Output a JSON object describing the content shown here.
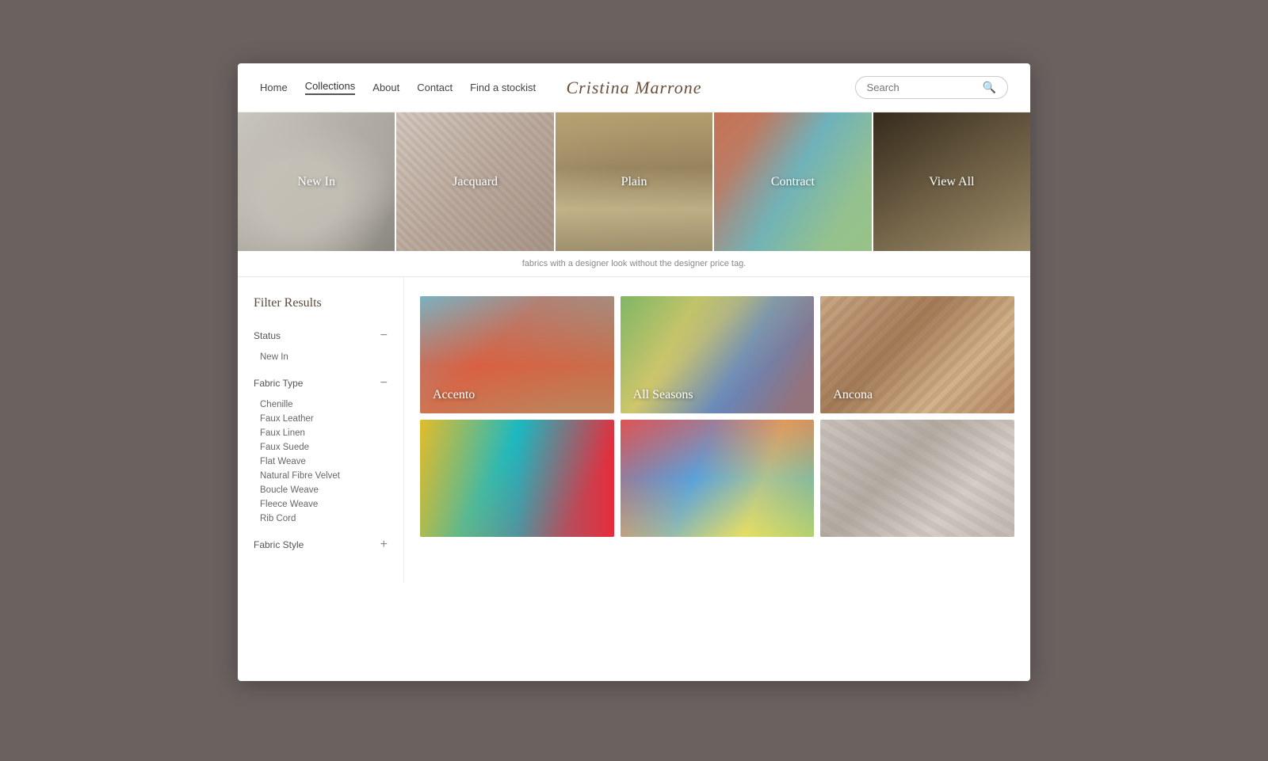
{
  "nav": {
    "links": [
      {
        "label": "Home",
        "active": false
      },
      {
        "label": "Collections",
        "active": true
      },
      {
        "label": "About",
        "active": false
      },
      {
        "label": "Contact",
        "active": false
      },
      {
        "label": "Find a stockist",
        "active": false
      }
    ],
    "logo": "Cristina Marrone",
    "search_placeholder": "Search"
  },
  "hero_banners": [
    {
      "label": "New In",
      "css_class": "banner-new-in"
    },
    {
      "label": "Jacquard",
      "css_class": "banner-jacquard"
    },
    {
      "label": "Plain",
      "css_class": "banner-plain"
    },
    {
      "label": "Contract",
      "css_class": "banner-contract"
    },
    {
      "label": "View All",
      "css_class": "banner-viewall"
    }
  ],
  "tagline": "fabrics with a designer look without the designer price tag.",
  "sidebar": {
    "title": "Filter Results",
    "sections": [
      {
        "name": "Status",
        "expanded": true,
        "items": [
          "New In"
        ]
      },
      {
        "name": "Fabric Type",
        "expanded": true,
        "items": [
          "Chenille",
          "Faux Leather",
          "Faux Linen",
          "Faux Suede",
          "Flat Weave",
          "Natural Fibre Velvet",
          "Boucle Weave",
          "Fleece Weave",
          "Rib Cord"
        ]
      },
      {
        "name": "Fabric Style",
        "expanded": false,
        "items": []
      }
    ]
  },
  "products": [
    {
      "label": "Accento",
      "css_class": "card-accento"
    },
    {
      "label": "All Seasons",
      "css_class": "card-allseasons"
    },
    {
      "label": "Ancona",
      "css_class": "card-ancona"
    },
    {
      "label": "",
      "css_class": "card-colorful"
    },
    {
      "label": "",
      "css_class": "card-multicolor"
    },
    {
      "label": "",
      "css_class": "card-neutral"
    }
  ]
}
